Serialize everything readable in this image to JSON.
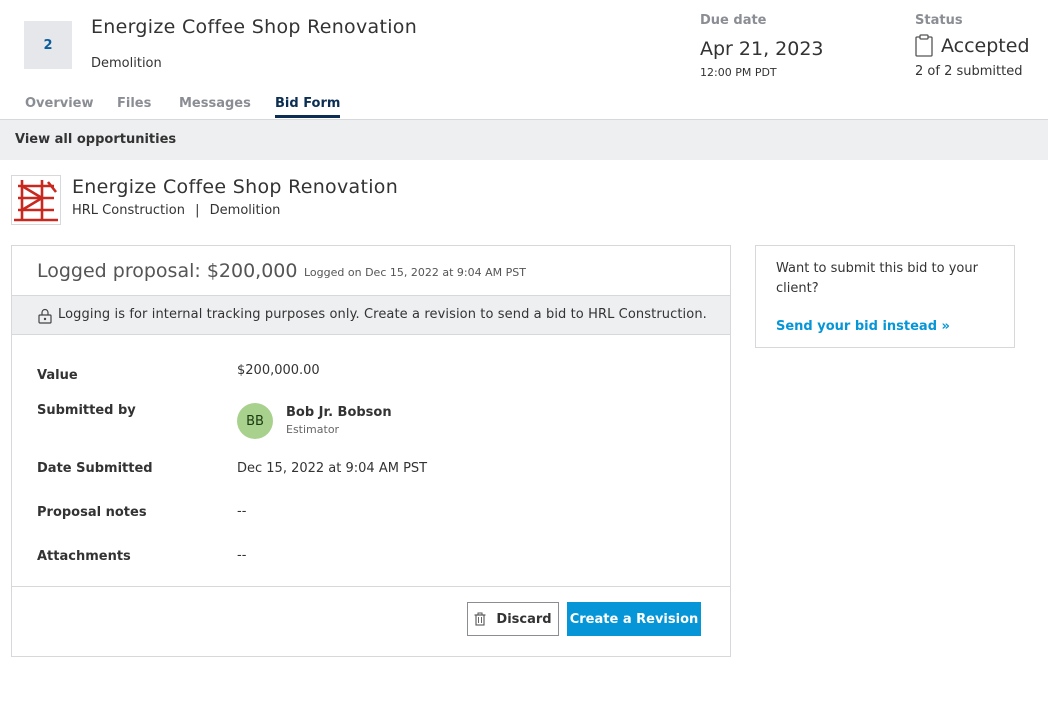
{
  "header": {
    "badge": "2",
    "title": "Energize Coffee Shop Renovation",
    "subtitle": "Demolition",
    "due_label": "Due date",
    "due_date": "Apr 21, 2023",
    "due_time": "12:00 PM PDT",
    "status_label": "Status",
    "status_value": "Accepted",
    "status_sub": "2 of 2 submitted"
  },
  "tabs": [
    {
      "label": "Overview",
      "active": false
    },
    {
      "label": "Files",
      "active": false
    },
    {
      "label": "Messages",
      "active": false
    },
    {
      "label": "Bid Form",
      "active": true
    }
  ],
  "subbar": {
    "link": "View all opportunities"
  },
  "company": {
    "title": "Energize Coffee Shop Renovation",
    "org": "HRL Construction",
    "separator": "|",
    "trade": "Demolition"
  },
  "proposal": {
    "title": "Logged proposal: $200,000",
    "meta": "Logged on Dec 15, 2022 at 9:04 AM PST",
    "notice": "Logging is for internal tracking purposes only. Create a revision to send a bid to HRL Construction.",
    "rows": {
      "value_label": "Value",
      "value": "$200,000.00",
      "submitted_by_label": "Submitted by",
      "avatar_initials": "BB",
      "person_name": "Bob Jr. Bobson",
      "person_role": "Estimator",
      "date_label": "Date Submitted",
      "date": "Dec 15, 2022 at 9:04 AM PST",
      "notes_label": "Proposal notes",
      "notes": "--",
      "attachments_label": "Attachments",
      "attachments": "--"
    },
    "discard_label": "Discard",
    "revision_label": "Create a Revision"
  },
  "side": {
    "text": "Want to submit this bid to your client?",
    "link": "Send your bid instead »"
  },
  "colors": {
    "accent": "#0696d7",
    "navy": "#0b2e52",
    "avatar": "#a9d18e",
    "logo_red": "#c8281e"
  }
}
